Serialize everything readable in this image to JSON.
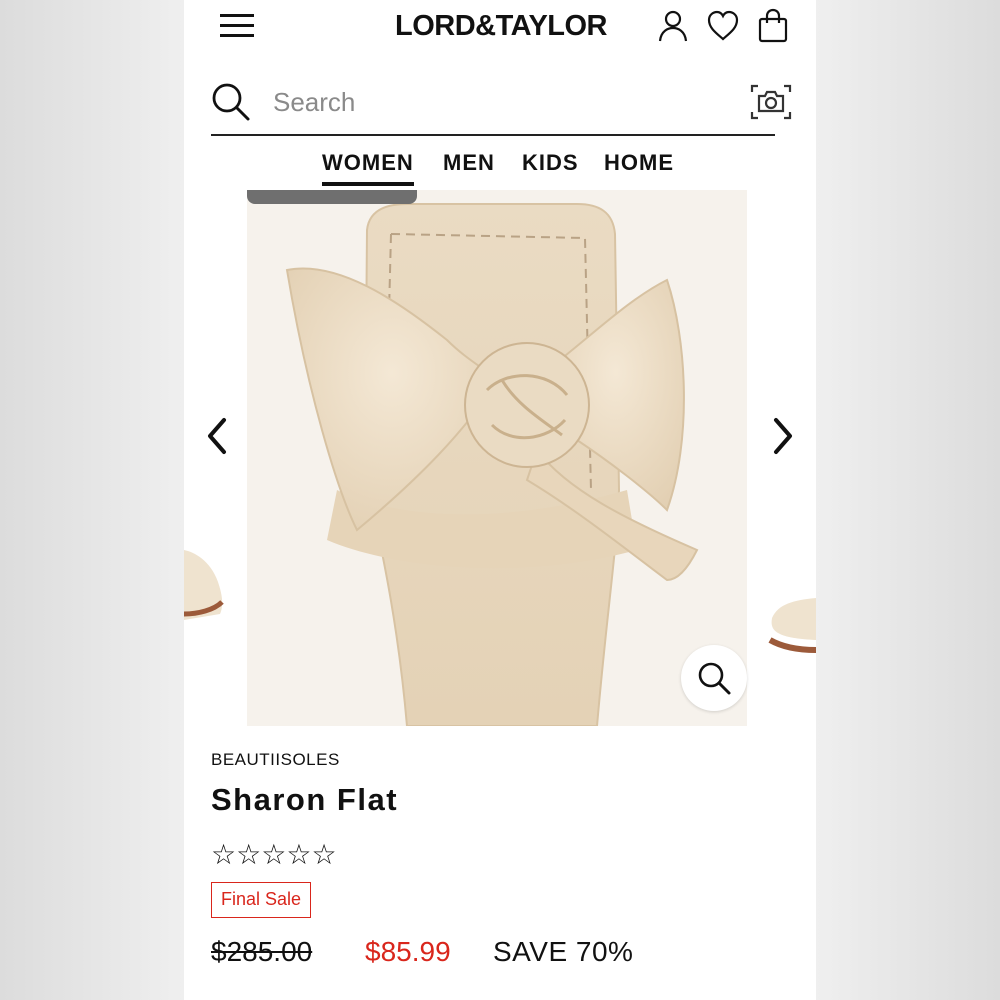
{
  "header": {
    "logo": "LORD&TAYLOR"
  },
  "search": {
    "placeholder": "Search"
  },
  "nav": {
    "items": [
      {
        "label": "WOMEN",
        "active": true
      },
      {
        "label": "MEN",
        "active": false
      },
      {
        "label": "KIDS",
        "active": false
      },
      {
        "label": "HOME",
        "active": false
      }
    ]
  },
  "icons": {
    "menu": "hamburger-menu-icon",
    "account": "account-icon",
    "wishlist": "heart-icon",
    "bag": "shopping-bag-icon",
    "search": "search-icon",
    "camera": "camera-icon",
    "prev": "chevron-left-icon",
    "next": "chevron-right-icon",
    "zoom": "zoom-icon"
  },
  "product": {
    "brand": "BEAUTIISOLES",
    "name": "Sharon Flat",
    "rating_stars": 0,
    "rating_max": 5,
    "badge": "Final Sale",
    "price_original": "$285.00",
    "price_sale": "$85.99",
    "savings": "SAVE 70%"
  },
  "colors": {
    "sale_red": "#d9261c",
    "text": "#111111",
    "shoe_cream": "#efe0c8"
  }
}
